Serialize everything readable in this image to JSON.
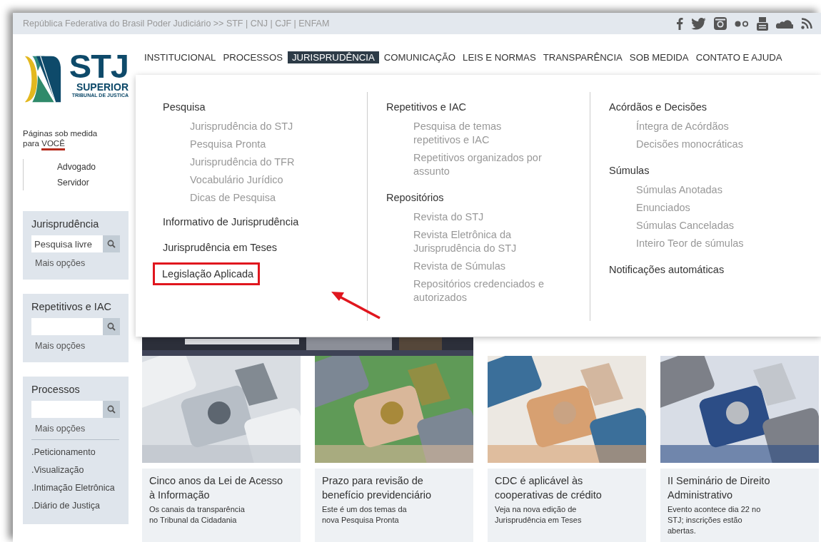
{
  "top_bar": {
    "breadcrumb": "República Federativa do Brasil Poder Judiciário >> STF | CNJ | CJF | ENFAM"
  },
  "logo": {
    "mark": "STJ",
    "name": "SUPERIOR",
    "subtitle": "TRIBUNAL DE JUSTICA"
  },
  "nav": [
    {
      "label": "INSTITUCIONAL",
      "selected": false
    },
    {
      "label": "PROCESSOS",
      "selected": false
    },
    {
      "label": "JURISPRUDÊNCIA",
      "selected": true
    },
    {
      "label": "COMUNICAÇÃO",
      "selected": false
    },
    {
      "label": "LEIS E NORMAS",
      "selected": false
    },
    {
      "label": "TRANSPARÊNCIA",
      "selected": false
    },
    {
      "label": "SOB MEDIDA",
      "selected": false
    },
    {
      "label": "CONTATO E AJUDA",
      "selected": false
    }
  ],
  "sidebar": {
    "intro": "Páginas sob medida para",
    "intro_emphasis": "VOCÊ",
    "audience_links": [
      "Advogado",
      "Servidor"
    ],
    "boxes": [
      {
        "title": "Jurisprudência",
        "placeholder": "Pesquisa livre",
        "more": "Mais opções"
      },
      {
        "title": "Repetitivos e IAC",
        "more": "Mais opções"
      },
      {
        "title": "Processos",
        "more": "Mais opções",
        "links": [
          ".Peticionamento",
          ".Visualização",
          ".Intimação Eletrônica",
          ".Diário de Justiça"
        ]
      }
    ]
  },
  "dropdown": {
    "columns": [
      {
        "groups": [
          {
            "label": "Pesquisa",
            "highlighted": false,
            "items": [
              "Jurisprudência do STJ",
              "Pesquisa Pronta",
              "Jurisprudência do TFR",
              "Vocabulário Jurídico",
              "Dicas de Pesquisa"
            ]
          },
          {
            "label": "Informativo de Jurisprudência",
            "highlighted": false
          },
          {
            "label": "Jurisprudência em Teses",
            "highlighted": false
          },
          {
            "label": "Legislação Aplicada",
            "highlighted": true
          }
        ]
      },
      {
        "groups": [
          {
            "label": "Repetitivos e IAC",
            "highlighted": false,
            "items": [
              "Pesquisa de temas repetitivos e IAC",
              "Repetitivos organizados por assunto"
            ]
          },
          {
            "label": "Repositórios",
            "highlighted": false,
            "items": [
              "Revista do STJ",
              "Revista Eletrônica da Jurisprudência do STJ",
              "Revista de Súmulas",
              "Repositórios credenciados e autorizados"
            ]
          }
        ]
      },
      {
        "groups": [
          {
            "label": "Acórdãos e Decisões",
            "highlighted": false,
            "items": [
              "Íntegra de Acórdãos",
              "Decisões monocráticas"
            ]
          },
          {
            "label": "Súmulas",
            "highlighted": false,
            "items": [
              "Súmulas Anotadas",
              "Enunciados",
              "Súmulas Canceladas",
              "Inteiro Teor de súmulas"
            ]
          },
          {
            "label": "Notificações automáticas",
            "highlighted": false
          }
        ]
      }
    ]
  },
  "news": [
    {
      "title": "Cinco anos da Lei de Acesso à Informação",
      "summary": "Os canais da transparência no Tribunal da Cidadania"
    },
    {
      "title": "Prazo para revisão de benefício previdenciário",
      "summary": "Este é um dos temas da nova Pesquisa Pronta"
    },
    {
      "title": "CDC é aplicável às cooperativas de crédito",
      "summary": "Veja na nova edição de Jurisprudência em Teses"
    },
    {
      "title": "II Seminário de Direito Administrativo",
      "summary": "Evento acontece dia 22 no STJ; inscrições estão abertas."
    }
  ]
}
